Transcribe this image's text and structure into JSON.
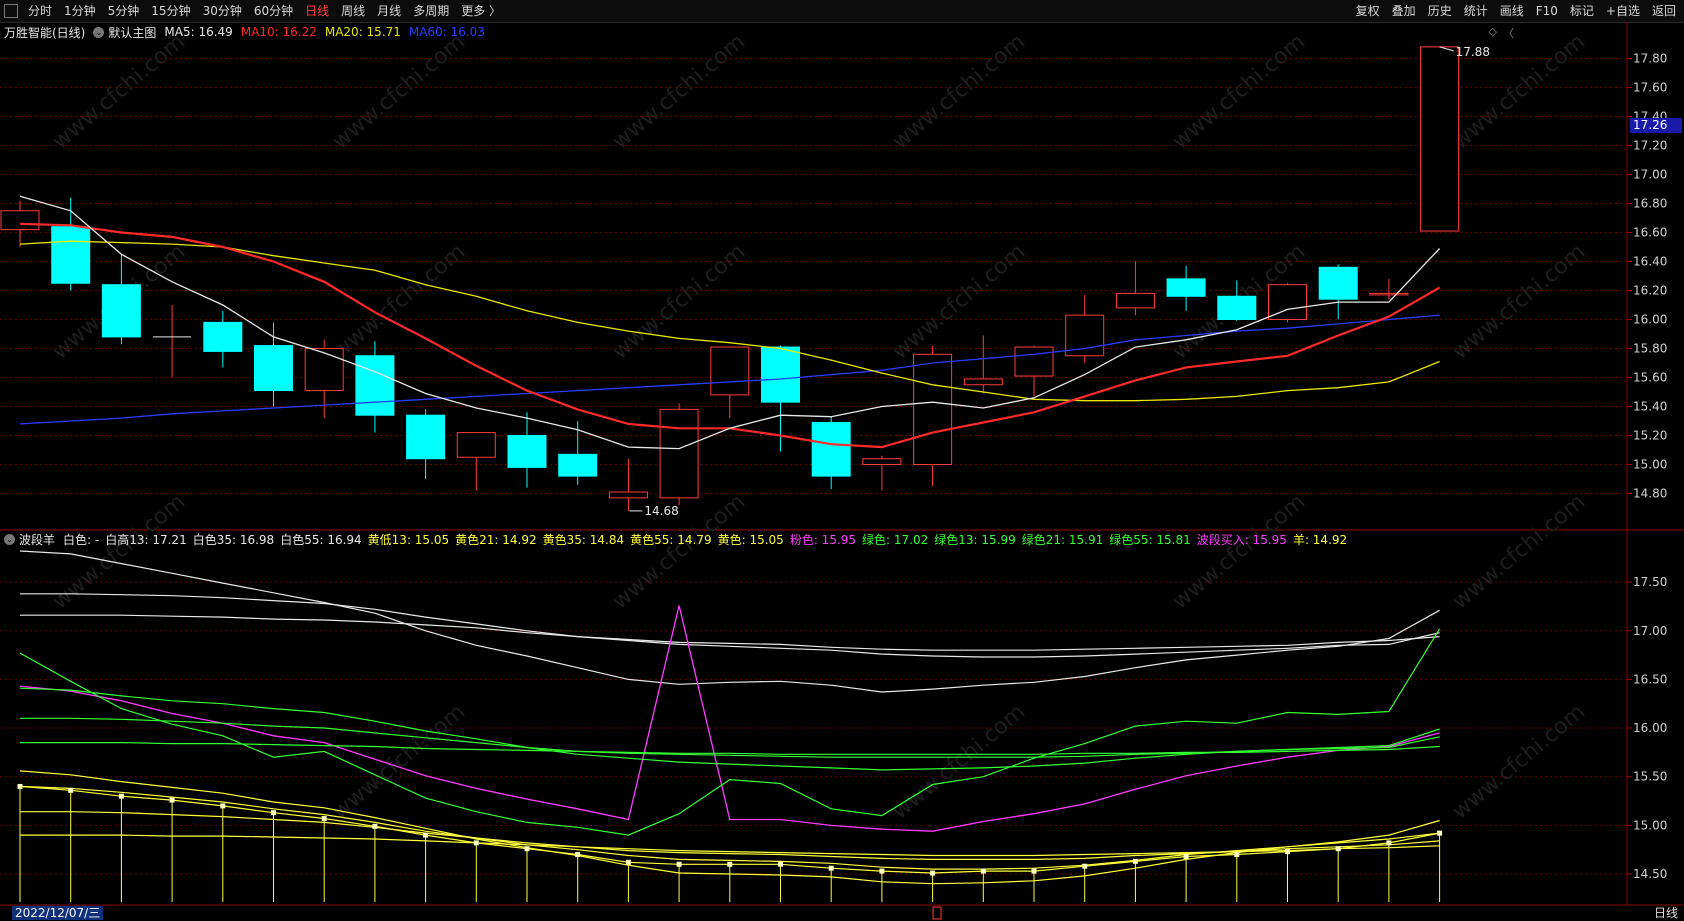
{
  "toolbar": {
    "left_items": [
      "分时",
      "1分钟",
      "5分钟",
      "15分钟",
      "30分钟",
      "60分钟",
      "日线",
      "周线",
      "月线",
      "多周期",
      "更多 〉"
    ],
    "active_item": "日线",
    "right_items": [
      "复权",
      "叠加",
      "历史",
      "统计",
      "画线",
      "F10",
      "标记",
      "+自选",
      "返回"
    ]
  },
  "main_legend": {
    "title": "万胜智能(日线)",
    "template": "默认主图",
    "ma": [
      {
        "label": "MA5: 16.49",
        "color": "#e8e8e8"
      },
      {
        "label": "MA10: 16.22",
        "color": "#ff2a2a"
      },
      {
        "label": "MA20: 15.71",
        "color": "#e8e800"
      },
      {
        "label": "MA60: 16.03",
        "color": "#2a3cff"
      }
    ]
  },
  "indicator_legend": {
    "name": "波段羊",
    "items": [
      {
        "label": "白色: -",
        "color": "#e8e8e8"
      },
      {
        "label": "白高13: 17.21",
        "color": "#e8e8e8"
      },
      {
        "label": "白色35: 16.98",
        "color": "#e8e8e8"
      },
      {
        "label": "白色55: 16.94",
        "color": "#e8e8e8"
      },
      {
        "label": "黄低13: 15.05",
        "color": "#ffff3a"
      },
      {
        "label": "黄色21: 14.92",
        "color": "#ffff3a"
      },
      {
        "label": "黄色35: 14.84",
        "color": "#ffff3a"
      },
      {
        "label": "黄色55: 14.79",
        "color": "#ffff3a"
      },
      {
        "label": "黄色: 15.05",
        "color": "#ffff3a"
      },
      {
        "label": "粉色: 15.95",
        "color": "#ff3cff"
      },
      {
        "label": "绿色: 17.02",
        "color": "#33ff33"
      },
      {
        "label": "绿色13: 15.99",
        "color": "#33ff33"
      },
      {
        "label": "绿色21: 15.91",
        "color": "#33ff33"
      },
      {
        "label": "绿色55: 15.81",
        "color": "#33ff33"
      },
      {
        "label": "波段买入: 15.95",
        "color": "#ff3cff"
      },
      {
        "label": "羊: 14.92",
        "color": "#ffff3a"
      }
    ]
  },
  "main_axis": {
    "ticks": [
      "17.80",
      "17.60",
      "17.40",
      "17.20",
      "17.00",
      "16.80",
      "16.60",
      "16.40",
      "16.20",
      "16.00",
      "15.80",
      "15.60",
      "15.40",
      "15.20",
      "15.00",
      "14.80"
    ],
    "current_price": "17.26"
  },
  "ind_axis": {
    "ticks": [
      "17.50",
      "17.00",
      "16.50",
      "16.00",
      "15.50",
      "15.00",
      "14.50"
    ]
  },
  "annotations": {
    "high": "17.88",
    "low": "14.68"
  },
  "status": {
    "date": "2022/12/07/三",
    "period": "日线"
  },
  "colors": {
    "up": "#ff3b3b",
    "down": "#00ffff",
    "grid": "#6b0000",
    "axis_text": "#d0d0d0"
  },
  "chart_data": {
    "type": "candlestick",
    "candles": [
      {
        "o": 16.62,
        "h": 16.82,
        "l": 16.5,
        "c": 16.75
      },
      {
        "o": 16.64,
        "h": 16.84,
        "l": 16.2,
        "c": 16.25
      },
      {
        "o": 16.24,
        "h": 16.45,
        "l": 15.83,
        "c": 15.88
      },
      {
        "o": 15.88,
        "h": 16.1,
        "l": 15.6,
        "c": 15.88
      },
      {
        "o": 15.98,
        "h": 16.06,
        "l": 15.67,
        "c": 15.78
      },
      {
        "o": 15.82,
        "h": 15.98,
        "l": 15.4,
        "c": 15.51
      },
      {
        "o": 15.51,
        "h": 15.86,
        "l": 15.32,
        "c": 15.8
      },
      {
        "o": 15.75,
        "h": 15.85,
        "l": 15.22,
        "c": 15.34
      },
      {
        "o": 15.34,
        "h": 15.38,
        "l": 14.9,
        "c": 15.04
      },
      {
        "o": 15.05,
        "h": 15.19,
        "l": 14.82,
        "c": 15.22
      },
      {
        "o": 15.2,
        "h": 15.36,
        "l": 14.84,
        "c": 14.98
      },
      {
        "o": 15.07,
        "h": 15.3,
        "l": 14.86,
        "c": 14.92
      },
      {
        "o": 14.77,
        "h": 15.04,
        "l": 14.68,
        "c": 14.81
      },
      {
        "o": 14.77,
        "h": 15.42,
        "l": 14.72,
        "c": 15.38
      },
      {
        "o": 15.48,
        "h": 15.8,
        "l": 15.32,
        "c": 15.81
      },
      {
        "o": 15.81,
        "h": 15.82,
        "l": 15.09,
        "c": 15.43
      },
      {
        "o": 15.29,
        "h": 15.33,
        "l": 14.83,
        "c": 14.92
      },
      {
        "o": 15.0,
        "h": 15.06,
        "l": 14.82,
        "c": 15.04
      },
      {
        "o": 15.0,
        "h": 15.82,
        "l": 14.85,
        "c": 15.76
      },
      {
        "o": 15.55,
        "h": 15.89,
        "l": 15.49,
        "c": 15.59
      },
      {
        "o": 15.61,
        "h": 15.82,
        "l": 15.47,
        "c": 15.81
      },
      {
        "o": 15.75,
        "h": 16.17,
        "l": 15.7,
        "c": 16.03
      },
      {
        "o": 16.08,
        "h": 16.4,
        "l": 16.03,
        "c": 16.18
      },
      {
        "o": 16.28,
        "h": 16.37,
        "l": 16.06,
        "c": 16.16
      },
      {
        "o": 16.16,
        "h": 16.27,
        "l": 15.99,
        "c": 16.0
      },
      {
        "o": 16.0,
        "h": 16.25,
        "l": 15.98,
        "c": 16.24
      },
      {
        "o": 16.36,
        "h": 16.38,
        "l": 16.0,
        "c": 16.14
      },
      {
        "o": 16.17,
        "h": 16.28,
        "l": 16.14,
        "c": 16.18
      },
      {
        "o": 16.61,
        "h": 17.88,
        "l": 16.61,
        "c": 17.88
      }
    ],
    "ma5": [
      16.85,
      16.75,
      16.45,
      16.26,
      16.1,
      15.88,
      15.77,
      15.64,
      15.49,
      15.39,
      15.32,
      15.24,
      15.12,
      15.11,
      15.25,
      15.34,
      15.33,
      15.4,
      15.43,
      15.39,
      15.46,
      15.62,
      15.81,
      15.86,
      15.93,
      16.07,
      16.12,
      16.12,
      16.49
    ],
    "ma10": [
      16.66,
      16.65,
      16.6,
      16.57,
      16.5,
      16.4,
      16.26,
      16.05,
      15.87,
      15.68,
      15.51,
      15.38,
      15.28,
      15.25,
      15.25,
      15.2,
      15.14,
      15.12,
      15.22,
      15.29,
      15.36,
      15.47,
      15.58,
      15.67,
      15.71,
      15.75,
      15.89,
      16.02,
      16.22
    ],
    "ma20": [
      16.52,
      16.54,
      16.53,
      16.52,
      16.5,
      16.44,
      16.39,
      16.34,
      16.24,
      16.16,
      16.06,
      15.98,
      15.92,
      15.87,
      15.84,
      15.8,
      15.72,
      15.63,
      15.55,
      15.5,
      15.45,
      15.44,
      15.44,
      15.45,
      15.47,
      15.51,
      15.53,
      15.57,
      15.71
    ],
    "ma60": [
      15.28,
      15.3,
      15.32,
      15.35,
      15.37,
      15.39,
      15.41,
      15.43,
      15.45,
      15.47,
      15.49,
      15.51,
      15.53,
      15.55,
      15.57,
      15.59,
      15.62,
      15.65,
      15.7,
      15.73,
      15.76,
      15.8,
      15.86,
      15.89,
      15.92,
      15.94,
      15.97,
      16.0,
      16.03
    ],
    "indicator": {
      "series": [
        {
          "name": "白色",
          "color": "#e8e8e8",
          "values": [
            17.82,
            17.79,
            17.69,
            17.59,
            17.49,
            17.39,
            17.29,
            17.18,
            17.0,
            16.85,
            16.74,
            16.62,
            16.5,
            16.45,
            16.47,
            16.48,
            16.44,
            16.37,
            16.4,
            16.44,
            16.47,
            16.53,
            16.62,
            16.7,
            16.75,
            16.8,
            16.84,
            16.92,
            17.21
          ]
        },
        {
          "name": "白色35",
          "color": "#e8e8e8",
          "values": [
            17.38,
            17.38,
            17.37,
            17.36,
            17.34,
            17.31,
            17.28,
            17.22,
            17.14,
            17.07,
            17.0,
            16.94,
            16.9,
            16.86,
            16.84,
            16.82,
            16.8,
            16.76,
            16.74,
            16.73,
            16.73,
            16.74,
            16.76,
            16.78,
            16.8,
            16.82,
            16.85,
            16.86,
            16.98
          ]
        },
        {
          "name": "白色55",
          "color": "#e8e8e8",
          "values": [
            17.16,
            17.16,
            17.16,
            17.15,
            17.14,
            17.12,
            17.11,
            17.09,
            17.06,
            17.03,
            16.98,
            16.94,
            16.91,
            16.88,
            16.87,
            16.86,
            16.83,
            16.81,
            16.8,
            16.8,
            16.8,
            16.81,
            16.82,
            16.83,
            16.84,
            16.85,
            16.88,
            16.9,
            16.94
          ]
        },
        {
          "name": "粉色",
          "color": "#ff3cff",
          "values": [
            16.43,
            16.38,
            16.28,
            16.15,
            16.05,
            15.92,
            15.85,
            15.68,
            15.51,
            15.38,
            15.27,
            15.17,
            15.06,
            15.0,
            15.06,
            15.06,
            15.0,
            14.96,
            14.94,
            15.04,
            15.12,
            15.22,
            15.37,
            15.51,
            15.61,
            15.7,
            15.77,
            15.81,
            15.95
          ]
        },
        {
          "name": "绿色",
          "color": "#33ff33",
          "values": [
            16.77,
            16.48,
            16.2,
            16.04,
            15.92,
            15.7,
            15.76,
            15.52,
            15.28,
            15.14,
            15.03,
            14.98,
            14.9,
            15.12,
            15.47,
            15.43,
            15.17,
            15.1,
            15.42,
            15.5,
            15.69,
            15.84,
            16.02,
            16.07,
            16.05,
            16.16,
            16.14,
            16.17,
            17.02
          ]
        },
        {
          "name": "绿色13",
          "color": "#33ff33",
          "values": [
            16.41,
            16.39,
            16.33,
            16.28,
            16.25,
            16.2,
            16.16,
            16.07,
            15.97,
            15.89,
            15.8,
            15.73,
            15.69,
            15.65,
            15.63,
            15.61,
            15.59,
            15.57,
            15.58,
            15.59,
            15.61,
            15.64,
            15.69,
            15.73,
            15.76,
            15.78,
            15.8,
            15.82,
            15.99
          ]
        },
        {
          "name": "绿色21",
          "color": "#33ff33",
          "values": [
            16.1,
            16.1,
            16.09,
            16.07,
            16.05,
            16.02,
            16.0,
            15.95,
            15.9,
            15.85,
            15.8,
            15.76,
            15.74,
            15.73,
            15.72,
            15.71,
            15.7,
            15.7,
            15.7,
            15.7,
            15.7,
            15.71,
            15.73,
            15.74,
            15.76,
            15.78,
            15.79,
            15.8,
            15.91
          ]
        },
        {
          "name": "绿色55",
          "color": "#33ff33",
          "values": [
            15.85,
            15.85,
            15.85,
            15.84,
            15.84,
            15.83,
            15.82,
            15.81,
            15.79,
            15.78,
            15.77,
            15.76,
            15.75,
            15.74,
            15.74,
            15.73,
            15.73,
            15.73,
            15.73,
            15.73,
            15.73,
            15.74,
            15.74,
            15.75,
            15.75,
            15.76,
            15.77,
            15.78,
            15.81
          ]
        },
        {
          "name": "黄低13",
          "color": "#ffff3a",
          "values": [
            15.56,
            15.52,
            15.45,
            15.39,
            15.33,
            15.24,
            15.18,
            15.08,
            14.97,
            14.86,
            14.77,
            14.69,
            14.59,
            14.51,
            14.5,
            14.49,
            14.47,
            14.42,
            14.4,
            14.41,
            14.43,
            14.48,
            14.56,
            14.65,
            14.72,
            14.78,
            14.83,
            14.9,
            15.05
          ]
        },
        {
          "name": "黄色21",
          "color": "#ffff3a",
          "values": [
            15.4,
            15.38,
            15.34,
            15.29,
            15.24,
            15.17,
            15.11,
            15.03,
            14.94,
            14.87,
            14.8,
            14.75,
            14.69,
            14.65,
            14.64,
            14.63,
            14.61,
            14.57,
            14.55,
            14.55,
            14.56,
            14.59,
            14.64,
            14.7,
            14.74,
            14.78,
            14.82,
            14.86,
            14.92
          ]
        },
        {
          "name": "黄色35",
          "color": "#ffff3a",
          "values": [
            15.14,
            15.14,
            15.13,
            15.11,
            15.09,
            15.06,
            15.03,
            14.98,
            14.92,
            14.87,
            14.82,
            14.78,
            14.74,
            14.72,
            14.71,
            14.7,
            14.68,
            14.66,
            14.65,
            14.65,
            14.65,
            14.66,
            14.69,
            14.71,
            14.73,
            14.76,
            14.78,
            14.8,
            14.84
          ]
        },
        {
          "name": "黄色55",
          "color": "#ffff3a",
          "values": [
            14.9,
            14.9,
            14.9,
            14.89,
            14.89,
            14.88,
            14.87,
            14.86,
            14.84,
            14.82,
            14.8,
            14.78,
            14.76,
            14.74,
            14.73,
            14.72,
            14.71,
            14.7,
            14.69,
            14.69,
            14.69,
            14.7,
            14.71,
            14.72,
            14.73,
            14.74,
            14.76,
            14.77,
            14.79
          ]
        },
        {
          "name": "羊",
          "color": "#ffff3a",
          "values": [
            15.4,
            15.36,
            15.3,
            15.26,
            15.2,
            15.13,
            15.07,
            14.99,
            14.9,
            14.82,
            14.76,
            14.7,
            14.62,
            14.6,
            14.6,
            14.6,
            14.56,
            14.53,
            14.51,
            14.53,
            14.53,
            14.58,
            14.63,
            14.68,
            14.7,
            14.73,
            14.76,
            14.82,
            14.92
          ]
        }
      ],
      "pink_spike": {
        "from": 12,
        "peak": 13,
        "to": 14,
        "peak_value": 17.26
      }
    }
  }
}
